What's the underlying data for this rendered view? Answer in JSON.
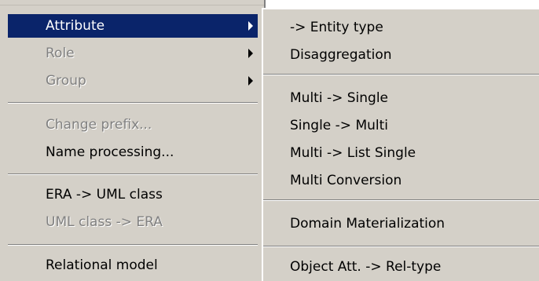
{
  "main_menu": {
    "items": [
      {
        "label": "Attribute",
        "state": "highlighted",
        "submenu": true
      },
      {
        "label": "Role",
        "state": "disabled",
        "submenu": true
      },
      {
        "label": "Group",
        "state": "disabled",
        "submenu": true
      },
      {
        "label": "Change prefix...",
        "state": "disabled"
      },
      {
        "label": "Name processing...",
        "state": "enabled"
      },
      {
        "label": "ERA -> UML class",
        "state": "enabled"
      },
      {
        "label": "UML class -> ERA",
        "state": "disabled"
      },
      {
        "label": "Relational model",
        "state": "enabled"
      }
    ]
  },
  "sub_menu": {
    "items": [
      {
        "label": "-> Entity type"
      },
      {
        "label": "Disaggregation"
      },
      {
        "label": "Multi -> Single"
      },
      {
        "label": "Single -> Multi"
      },
      {
        "label": "Multi -> List Single"
      },
      {
        "label": "Multi Conversion"
      },
      {
        "label": "Domain Materialization"
      },
      {
        "label": "Object Att. -> Rel-type"
      }
    ]
  },
  "colors": {
    "menu_bg": "#d4d0c8",
    "highlight_bg": "#0a246a",
    "highlight_text": "#ffffff",
    "disabled_text": "#808080"
  }
}
